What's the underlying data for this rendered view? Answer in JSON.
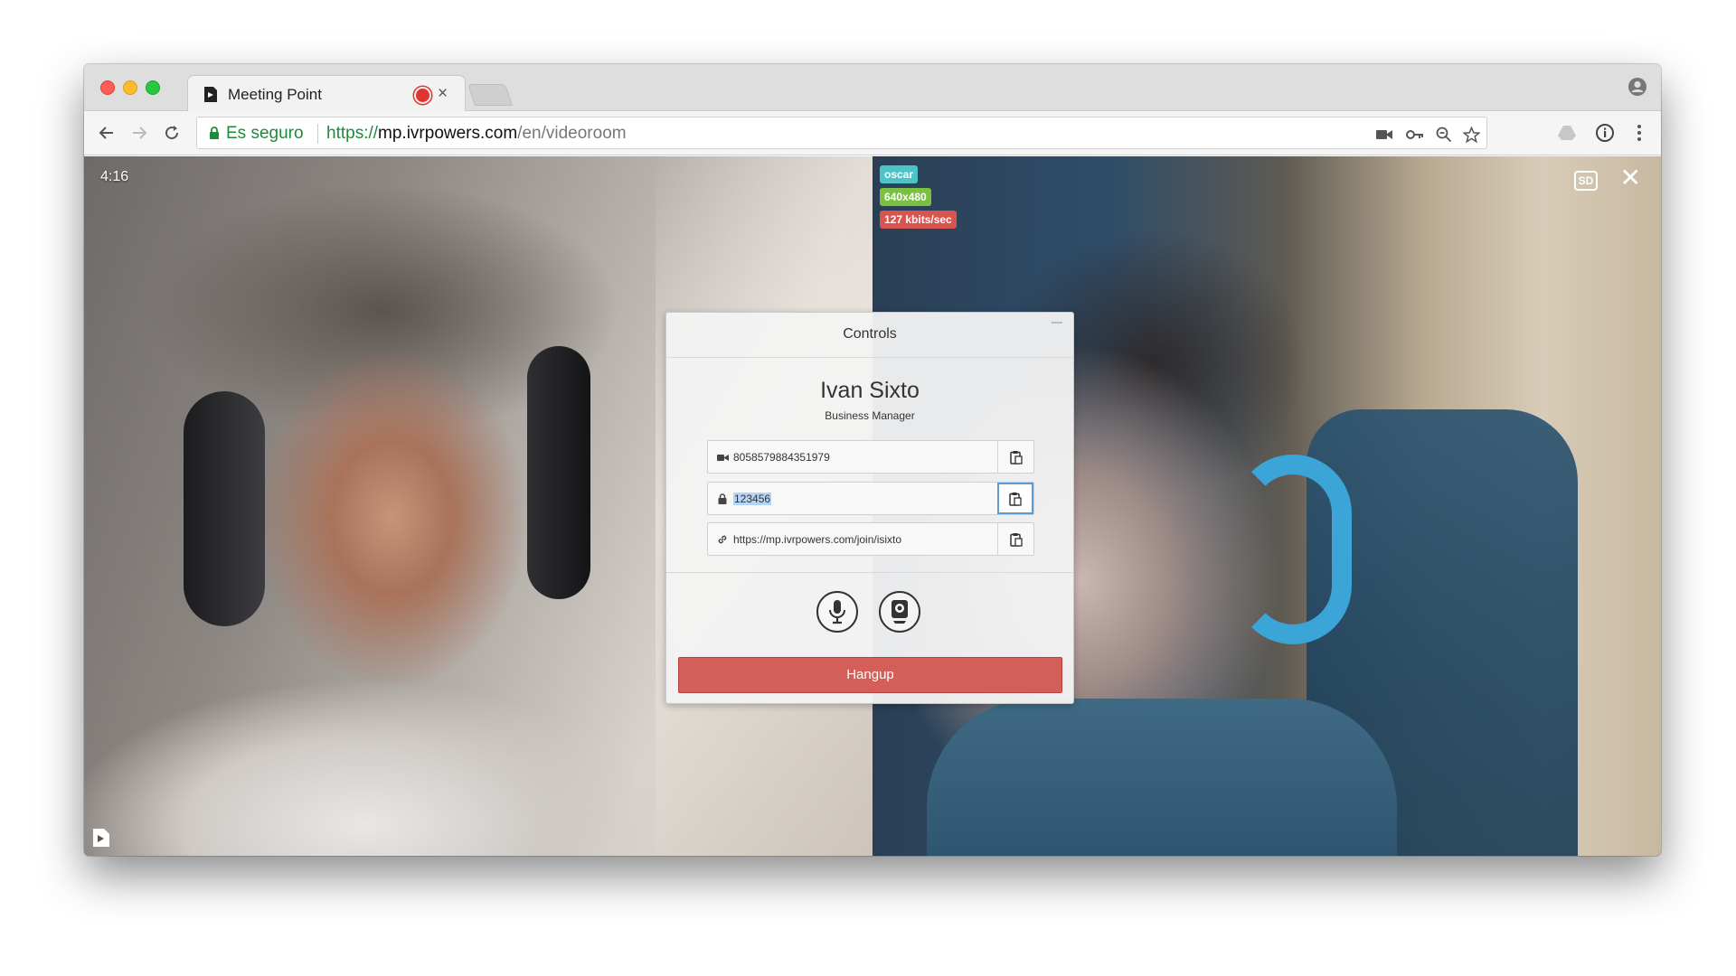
{
  "browser": {
    "tab_title": "Meeting Point",
    "security_label": "Es seguro",
    "url": {
      "scheme": "https://",
      "host": "mp.ivrpowers.com",
      "path": "/en/videoroom"
    }
  },
  "call": {
    "elapsed": "4:16",
    "remote_stats": {
      "user": "oscar",
      "resolution": "640x480",
      "bitrate": "127 kbits/sec"
    },
    "quality_label": "SD"
  },
  "controls": {
    "title": "Controls",
    "user_name": "Ivan Sixto",
    "user_role": "Business Manager",
    "room_id": "8058579884351979",
    "pin": "123456",
    "join_link": "https://mp.ivrpowers.com/join/isixto",
    "hangup_label": "Hangup"
  },
  "colors": {
    "hangup": "#d35f58",
    "badge_user": "#4cc3c7",
    "badge_resolution": "#7bc043",
    "badge_bitrate": "#d9534f",
    "secure_green": "#1e8a3a"
  }
}
